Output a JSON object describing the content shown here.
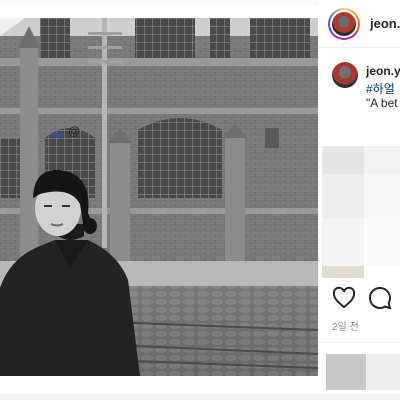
{
  "post": {
    "username": "jeon.y",
    "caption": {
      "username": "jeon.y",
      "hashtag": "#하얼",
      "text": "\"A bet",
      "emoji_badge": "▄▄",
      "mention": "@"
    },
    "timestamp": "2일 전"
  },
  "actions": {
    "like_icon": "heart-icon",
    "comment_icon": "comment-icon"
  },
  "colors": {
    "link": "#00376b",
    "meta": "#8e8e8e",
    "text": "#262626"
  }
}
